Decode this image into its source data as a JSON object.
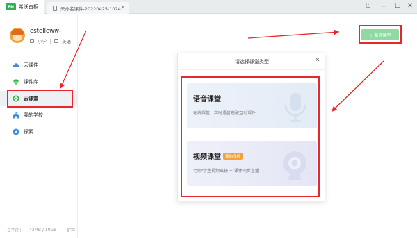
{
  "titlebar": {
    "app_logo_text": "EN",
    "app_name": "希沃白板",
    "doc_tab_label": "未命名课件-20220425-1024",
    "doc_tab_close": "✕",
    "ctrl_help": "⍞",
    "ctrl_minimize": "—",
    "ctrl_maximize": "☐",
    "ctrl_close": "✕"
  },
  "user": {
    "name": "estelleww",
    "caret": "▾",
    "grade": "小学",
    "subject": "英语"
  },
  "sidebar": {
    "items": [
      {
        "label": "云课件",
        "icon": "cloud-icon",
        "active": false
      },
      {
        "label": "课件库",
        "icon": "diamond-icon",
        "active": false
      },
      {
        "label": "云课堂",
        "icon": "play-circle-icon",
        "active": true
      },
      {
        "label": "我的学校",
        "icon": "school-icon",
        "active": false
      },
      {
        "label": "探索",
        "icon": "compass-icon",
        "active": false
      }
    ],
    "storage_label": "云空间：",
    "storage_value": "42MB / 10GB",
    "storage_expand": "扩容"
  },
  "main": {
    "new_class_button": "+ 新建课堂"
  },
  "modal": {
    "title": "请选择课堂类型",
    "close": "✕",
    "cards": [
      {
        "title": "语音课堂",
        "badge": "",
        "desc": "在线课堂，实时语音搭配互动课件"
      },
      {
        "title": "视频课堂",
        "badge": "双向视频",
        "desc": "老师/学生视频出镜 + 课件同步直播"
      }
    ]
  },
  "colors": {
    "brand_green": "#2fb14e",
    "button_green": "#8fd9a3",
    "annotation_red": "#e8262b",
    "badge_orange": "#f2a23b"
  }
}
